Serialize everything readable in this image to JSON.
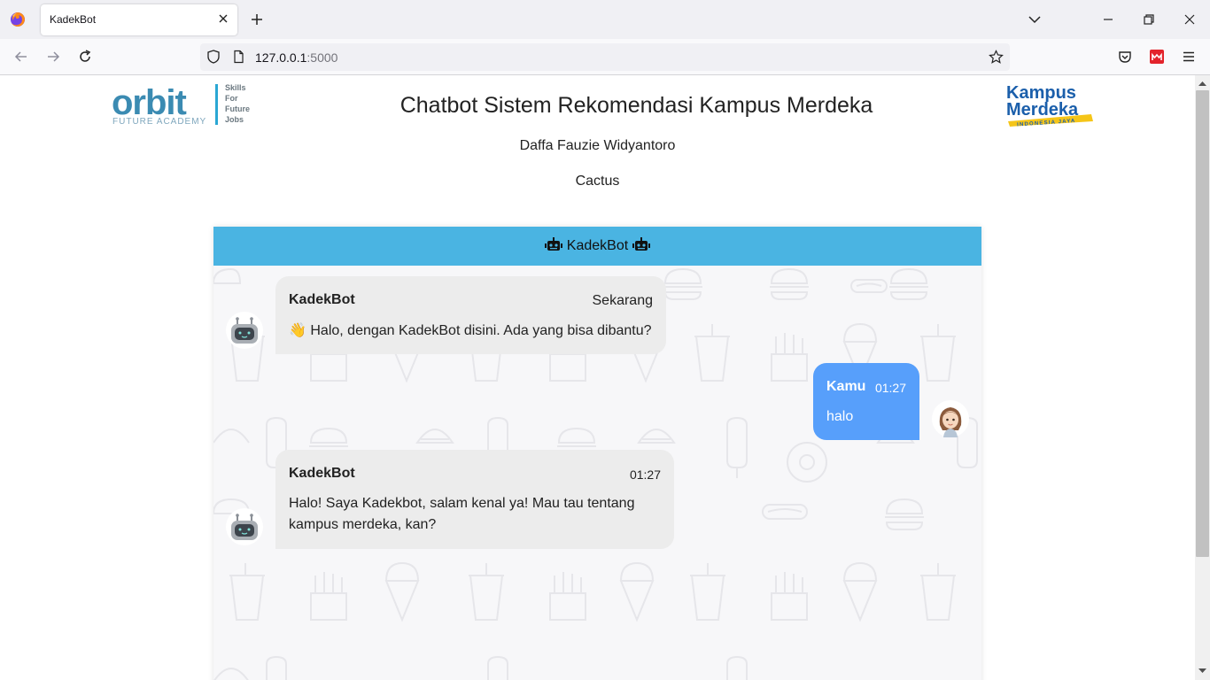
{
  "browser": {
    "tab_title": "KadekBot",
    "url_host": "127.0.0.1",
    "url_port": ":5000"
  },
  "page": {
    "title": "Chatbot Sistem Rekomendasi Kampus Merdeka",
    "author": "Daffa Fauzie Widyantoro",
    "team": "Cactus",
    "orbit_logo": {
      "main": "orbit",
      "sub": "FUTURE ACADEMY",
      "tagline": [
        "Skills",
        "For",
        "Future",
        "Jobs"
      ]
    },
    "km_logo": {
      "line1": "Kampus",
      "line2": "Merdeka",
      "line3": "INDONESIA JAYA"
    }
  },
  "chat": {
    "header": "KadekBot",
    "messages": [
      {
        "sender": "KadekBot",
        "time": "Sekarang",
        "text": "Halo, dengan KadekBot disini. Ada yang bisa dibantu?",
        "emoji": "👋"
      },
      {
        "sender": "Kamu",
        "time": "01:27",
        "text": "halo"
      },
      {
        "sender": "KadekBot",
        "time": "01:27",
        "text": "Halo! Saya Kadekbot, salam kenal ya! Mau tau tentang kampus merdeka, kan?"
      }
    ]
  },
  "colors": {
    "chat_header": "#4ab4e2",
    "user_bubble": "#579ffb",
    "bot_bubble": "#ececec"
  },
  "icons": [
    "firefox-icon",
    "close-icon",
    "plus-icon",
    "chevron-down-icon",
    "back-icon",
    "forward-icon",
    "reload-icon",
    "shield-icon",
    "page-icon",
    "star-icon",
    "pocket-icon",
    "extension-icon",
    "menu-icon",
    "robot-icon"
  ]
}
